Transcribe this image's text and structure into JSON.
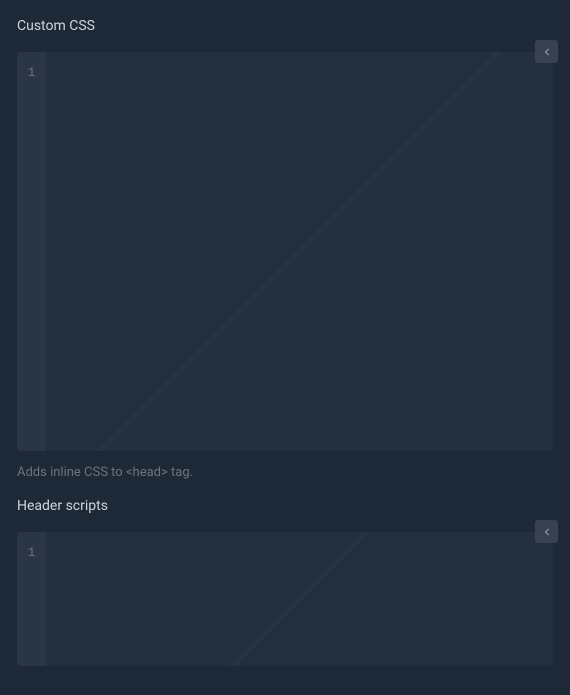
{
  "sections": {
    "customCss": {
      "label": "Custom CSS",
      "lineNumber": "1",
      "helperText": "Adds inline CSS to <head> tag."
    },
    "headerScripts": {
      "label": "Header scripts",
      "lineNumber": "1"
    }
  }
}
